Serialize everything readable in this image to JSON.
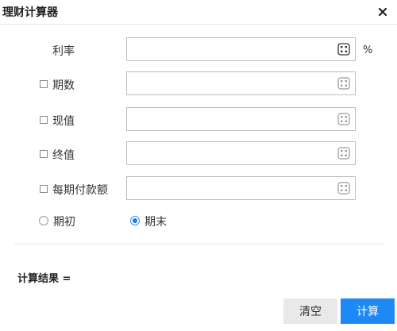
{
  "window": {
    "title": "理财计算器"
  },
  "icons": {
    "close": "close-icon",
    "calculator": "calculator-icon"
  },
  "form": {
    "rate": {
      "label": "利率",
      "unit": "%",
      "value": ""
    },
    "periods": {
      "label": "期数",
      "checked": false,
      "value": ""
    },
    "present_value": {
      "label": "现值",
      "checked": false,
      "value": ""
    },
    "future_value": {
      "label": "终值",
      "checked": false,
      "value": ""
    },
    "payment": {
      "label": "每期付款额",
      "checked": false,
      "value": ""
    }
  },
  "timing": {
    "options": [
      {
        "label": "期初",
        "selected": false
      },
      {
        "label": "期末",
        "selected": true
      }
    ]
  },
  "result": {
    "label": "计算结果 ="
  },
  "buttons": {
    "clear": "清空",
    "calculate": "计算"
  },
  "colors": {
    "primary": "#1e88f5",
    "secondary_button": "#e9e9e9",
    "border": "#bdbdbd"
  }
}
